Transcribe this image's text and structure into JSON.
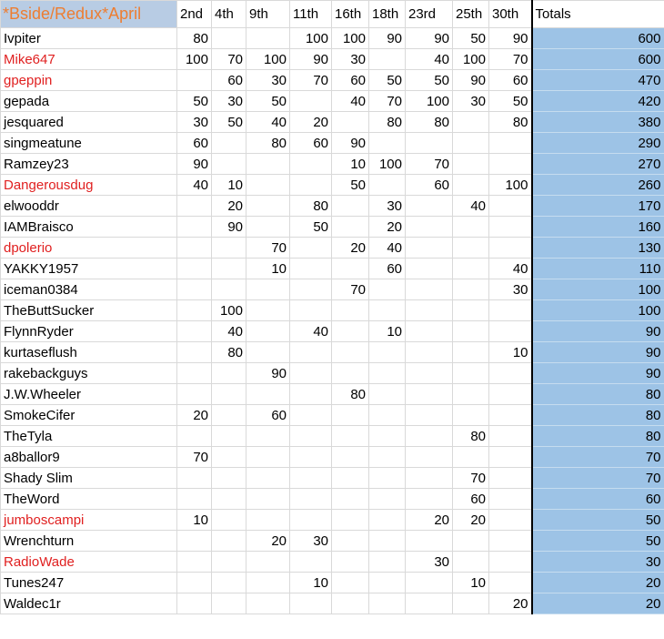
{
  "title": "*Bside/Redux*April",
  "columns": [
    "2nd",
    "4th",
    "9th",
    "11th",
    "16th",
    "18th",
    "23rd",
    "25th",
    "30th"
  ],
  "totals_label": "Totals",
  "colors": {
    "red_name": "#e02020",
    "title": "#ed7d31",
    "totals_fill": "#9dc3e6"
  },
  "rows": [
    {
      "name": "Ivpiter",
      "red": false,
      "scores": [
        "80",
        "",
        "",
        "100",
        "100",
        "90",
        "90",
        "50",
        "90"
      ],
      "total": "600"
    },
    {
      "name": "Mike647",
      "red": true,
      "scores": [
        "100",
        "70",
        "100",
        "90",
        "30",
        "",
        "40",
        "100",
        "70"
      ],
      "total": "600"
    },
    {
      "name": "gpeppin",
      "red": true,
      "scores": [
        "",
        "60",
        "30",
        "70",
        "60",
        "50",
        "50",
        "90",
        "60"
      ],
      "total": "470"
    },
    {
      "name": "gepada",
      "red": false,
      "scores": [
        "50",
        "30",
        "50",
        "",
        "40",
        "70",
        "100",
        "30",
        "50"
      ],
      "total": "420"
    },
    {
      "name": "jesquared",
      "red": false,
      "scores": [
        "30",
        "50",
        "40",
        "20",
        "",
        "80",
        "80",
        "",
        "80"
      ],
      "total": "380"
    },
    {
      "name": "singmeatune",
      "red": false,
      "scores": [
        "60",
        "",
        "80",
        "60",
        "90",
        "",
        "",
        "",
        ""
      ],
      "total": "290"
    },
    {
      "name": "Ramzey23",
      "red": false,
      "scores": [
        "90",
        "",
        "",
        "",
        "10",
        "100",
        "70",
        "",
        ""
      ],
      "total": "270"
    },
    {
      "name": "Dangerousdug",
      "red": true,
      "scores": [
        "40",
        "10",
        "",
        "",
        "50",
        "",
        "60",
        "",
        "100"
      ],
      "total": "260"
    },
    {
      "name": "elwooddr",
      "red": false,
      "scores": [
        "",
        "20",
        "",
        "80",
        "",
        "30",
        "",
        "40",
        ""
      ],
      "total": "170"
    },
    {
      "name": "IAMBraisco",
      "red": false,
      "scores": [
        "",
        "90",
        "",
        "50",
        "",
        "20",
        "",
        "",
        ""
      ],
      "total": "160"
    },
    {
      "name": "dpolerio",
      "red": true,
      "scores": [
        "",
        "",
        "70",
        "",
        "20",
        "40",
        "",
        "",
        ""
      ],
      "total": "130"
    },
    {
      "name": "YAKKY1957",
      "red": false,
      "scores": [
        "",
        "",
        "10",
        "",
        "",
        "60",
        "",
        "",
        "40"
      ],
      "total": "110"
    },
    {
      "name": "iceman0384",
      "red": false,
      "scores": [
        "",
        "",
        "",
        "",
        "70",
        "",
        "",
        "",
        "30"
      ],
      "total": "100"
    },
    {
      "name": "TheButtSucker",
      "red": false,
      "scores": [
        "",
        "100",
        "",
        "",
        "",
        "",
        "",
        "",
        ""
      ],
      "total": "100"
    },
    {
      "name": "FlynnRyder",
      "red": false,
      "scores": [
        "",
        "40",
        "",
        "40",
        "",
        "10",
        "",
        "",
        ""
      ],
      "total": "90"
    },
    {
      "name": "kurtaseflush",
      "red": false,
      "scores": [
        "",
        "80",
        "",
        "",
        "",
        "",
        "",
        "",
        "10"
      ],
      "total": "90"
    },
    {
      "name": "rakebackguys",
      "red": false,
      "scores": [
        "",
        "",
        "90",
        "",
        "",
        "",
        "",
        "",
        ""
      ],
      "total": "90"
    },
    {
      "name": "J.W.Wheeler",
      "red": false,
      "scores": [
        "",
        "",
        "",
        "",
        "80",
        "",
        "",
        "",
        ""
      ],
      "total": "80"
    },
    {
      "name": "SmokeCifer",
      "red": false,
      "scores": [
        "20",
        "",
        "60",
        "",
        "",
        "",
        "",
        "",
        ""
      ],
      "total": "80"
    },
    {
      "name": "TheTyla",
      "red": false,
      "scores": [
        "",
        "",
        "",
        "",
        "",
        "",
        "",
        "80",
        ""
      ],
      "total": "80"
    },
    {
      "name": "a8ballor9",
      "red": false,
      "scores": [
        "70",
        "",
        "",
        "",
        "",
        "",
        "",
        "",
        ""
      ],
      "total": "70"
    },
    {
      "name": "Shady Slim",
      "red": false,
      "scores": [
        "",
        "",
        "",
        "",
        "",
        "",
        "",
        "70",
        ""
      ],
      "total": "70"
    },
    {
      "name": "TheWord",
      "red": false,
      "scores": [
        "",
        "",
        "",
        "",
        "",
        "",
        "",
        "60",
        ""
      ],
      "total": "60"
    },
    {
      "name": "jumboscampi",
      "red": true,
      "scores": [
        "10",
        "",
        "",
        "",
        "",
        "",
        "20",
        "20",
        ""
      ],
      "total": "50"
    },
    {
      "name": "Wrenchturn",
      "red": false,
      "scores": [
        "",
        "",
        "20",
        "30",
        "",
        "",
        "",
        "",
        ""
      ],
      "total": "50"
    },
    {
      "name": "RadioWade",
      "red": true,
      "scores": [
        "",
        "",
        "",
        "",
        "",
        "",
        "30",
        "",
        ""
      ],
      "total": "30"
    },
    {
      "name": "Tunes247",
      "red": false,
      "scores": [
        "",
        "",
        "",
        "10",
        "",
        "",
        "",
        "10",
        ""
      ],
      "total": "20"
    },
    {
      "name": "Waldec1r",
      "red": false,
      "scores": [
        "",
        "",
        "",
        "",
        "",
        "",
        "",
        "",
        "20"
      ],
      "total": "20"
    }
  ]
}
